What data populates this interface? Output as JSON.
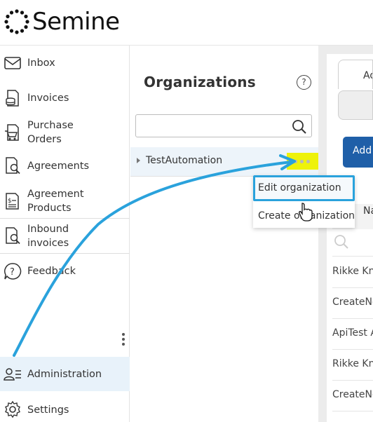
{
  "app": {
    "brand": "Semine"
  },
  "sidebar": {
    "items": [
      {
        "label": "Inbox",
        "icon": "inbox-icon"
      },
      {
        "label": "Invoices",
        "icon": "invoices-icon"
      },
      {
        "label": "Purchase\nOrders",
        "icon": "purchase-orders-icon"
      },
      {
        "label": "Agreements",
        "icon": "agreements-icon"
      },
      {
        "label": "Agreement\nProducts",
        "icon": "agreement-products-icon"
      },
      {
        "label": "Inbound\ninvoices",
        "icon": "inbound-invoices-icon"
      },
      {
        "label": "Feedback",
        "icon": "feedback-icon"
      },
      {
        "label": "Administration",
        "icon": "administration-icon",
        "active": true
      },
      {
        "label": "Settings",
        "icon": "settings-icon"
      }
    ]
  },
  "organizations": {
    "title": "Organizations",
    "help_label": "?",
    "search_placeholder": "",
    "rows": [
      {
        "name": "TestAutomation"
      }
    ]
  },
  "context_menu": {
    "items": [
      {
        "label": "Edit organization",
        "highlighted": true
      },
      {
        "label": "Create organization"
      }
    ]
  },
  "right_panel": {
    "tab_label": "Ad",
    "add_button_label": "Add",
    "column_header": "Nam",
    "rows": [
      "Rikke Kn",
      "CreateNe",
      "ApiTest A",
      "Rikke Kn",
      "CreateNe"
    ]
  },
  "colors": {
    "accent": "#1f5fa8",
    "highlight": "#eef20a",
    "annotation": "#2aa2dc",
    "active_bg": "#e8f2fa"
  }
}
